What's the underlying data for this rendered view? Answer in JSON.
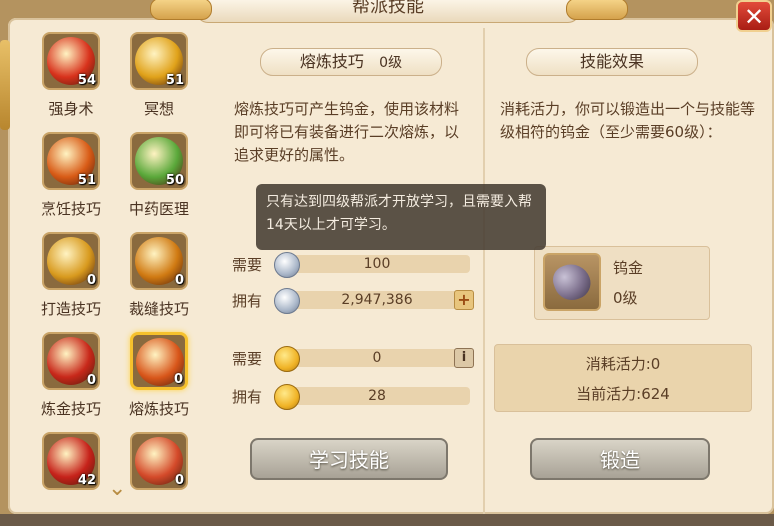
{
  "window": {
    "title": "帮派技能",
    "close": "✕"
  },
  "skills": [
    {
      "name": "强身术",
      "level": "54",
      "color": "#d8321c"
    },
    {
      "name": "冥想",
      "level": "51",
      "color": "#e0a21a"
    },
    {
      "name": "烹饪技巧",
      "level": "51",
      "color": "#d85b16"
    },
    {
      "name": "中药医理",
      "level": "50",
      "color": "#5aa83a"
    },
    {
      "name": "打造技巧",
      "level": "0",
      "color": "#d89a1e"
    },
    {
      "name": "裁缝技巧",
      "level": "0",
      "color": "#d07a12"
    },
    {
      "name": "炼金技巧",
      "level": "0",
      "color": "#c8281a"
    },
    {
      "name": "熔炼技巧",
      "level": "0",
      "color": "#d8561a"
    },
    {
      "name": "",
      "level": "42",
      "color": "#c6221a"
    },
    {
      "name": "",
      "level": "0",
      "color": "#d44a2a"
    }
  ],
  "middle": {
    "tag_label": "熔炼技巧",
    "tag_level": "0级",
    "description": "熔炼技巧可产生钨金，使用该材料即可将已有装备进行二次熔炼，以追求更好的属性。",
    "rows": [
      {
        "label": "需要",
        "value": "100",
        "coin": "silver"
      },
      {
        "label": "拥有",
        "value": "2,947,386",
        "coin": "silver"
      },
      {
        "label": "需要",
        "value": "0",
        "coin": "gold"
      },
      {
        "label": "拥有",
        "value": "28",
        "coin": "gold"
      }
    ],
    "plus": "+",
    "info": "i",
    "learn_button": "学习技能"
  },
  "tooltip": {
    "text": "只有达到四级帮派才开放学习，且需要入帮14天以上才可学习。"
  },
  "right": {
    "tag_label": "技能效果",
    "description": "消耗活力，你可以锻造出一个与技能等级相符的钨金（至少需要60级）：",
    "item_name": "钨金",
    "item_level": "0级",
    "cost": "消耗活力:0",
    "current": "当前活力:624",
    "forge_button": "锻造"
  }
}
